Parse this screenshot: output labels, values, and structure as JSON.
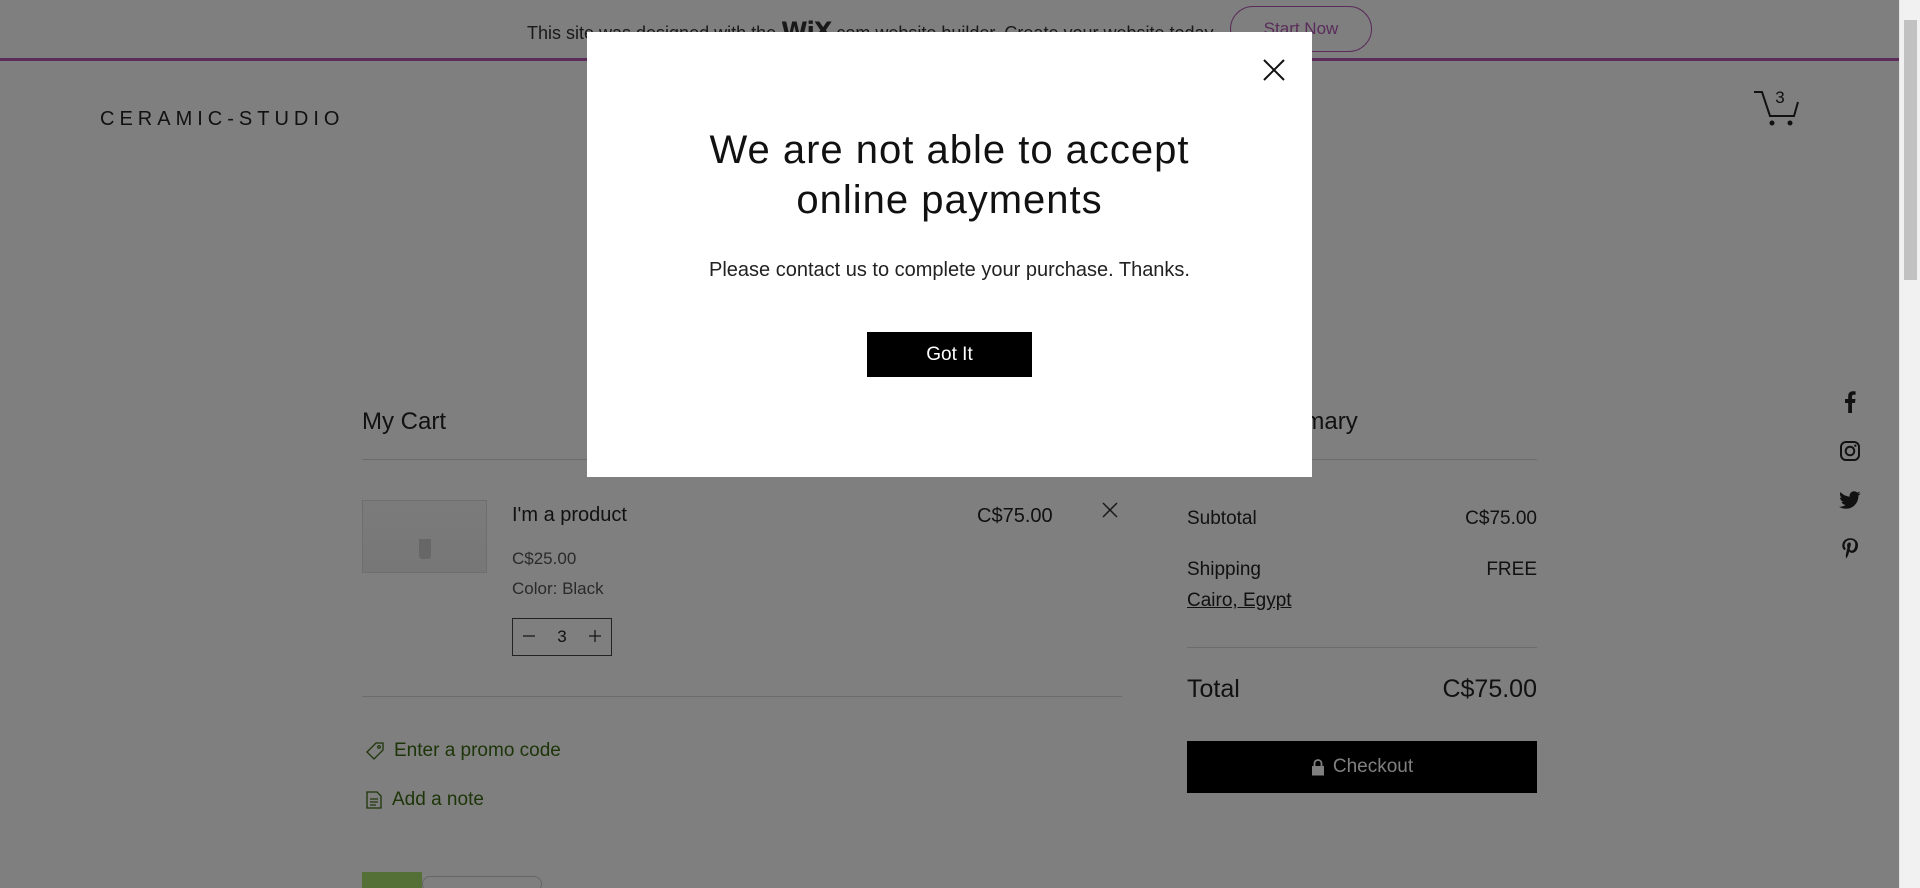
{
  "wix_banner": {
    "text_before": "This site was designed with the ",
    "logo": "WiX",
    "text_after": ".com website builder. Create your website today.",
    "start_button": "Start Now",
    "accent_color": "#b458b4"
  },
  "header": {
    "brand": "CERAMIC-STUDIO",
    "cart_count": "3",
    "cart_icon": "cart-icon"
  },
  "social": [
    "facebook-icon",
    "instagram-icon",
    "twitter-icon",
    "pinterest-icon"
  ],
  "cart": {
    "title": "My Cart",
    "item": {
      "name": "I'm a product",
      "unit_price": "C$25.00",
      "option": "Color: Black",
      "quantity": "3",
      "line_total": "C$75.00"
    },
    "promo_label": "Enter a promo code",
    "note_label": "Add a note"
  },
  "summary": {
    "title": "Order Summary",
    "subtotal_label": "Subtotal",
    "subtotal_value": "C$75.00",
    "shipping_label": "Shipping",
    "shipping_value": "FREE",
    "shipping_location": "Cairo, Egypt",
    "total_label": "Total",
    "total_value": "C$75.00",
    "checkout_label": "Checkout"
  },
  "modal": {
    "title_line1": "We are not able to accept",
    "title_line2": "online payments",
    "message": "Please contact us to complete your purchase. Thanks.",
    "button": "Got It"
  }
}
